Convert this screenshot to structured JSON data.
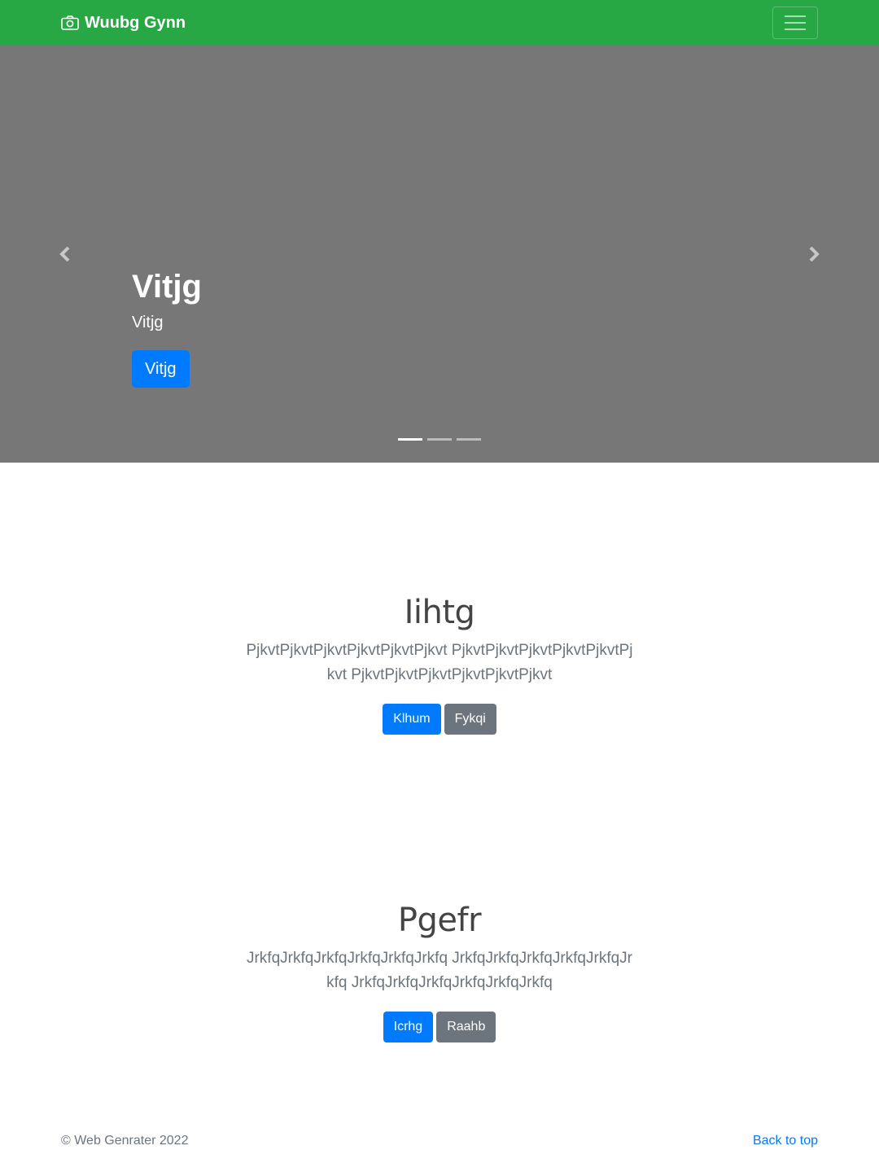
{
  "navbar": {
    "brand": "Wuubg Gynn",
    "brand_icon": "camera-icon",
    "toggler_icon": "hamburger-icon",
    "bg_color": "#28a745"
  },
  "carousel": {
    "slide": {
      "title": "Vitjg",
      "subtitle": "Vitjg",
      "button": "Vitjg"
    },
    "indicators": 3,
    "active_index": 0,
    "prev_icon": "chevron-left-icon",
    "next_icon": "chevron-right-icon"
  },
  "sections": [
    {
      "heading": "Iihtg",
      "text": "PjkvtPjkvtPjkvtPjkvtPjkvtPjkvt PjkvtPjkvtPjkvtPjkvtPjkvtPjkvt PjkvtPjkvtPjkvtPjkvtPjkvtPjkvt",
      "primary_button": "Klhum",
      "secondary_button": "Fykqi"
    },
    {
      "heading": "Pgefr",
      "text": "JrkfqJrkfqJrkfqJrkfqJrkfqJrkfq JrkfqJrkfqJrkfqJrkfqJrkfqJrkfq JrkfqJrkfqJrkfqJrkfqJrkfqJrkfq",
      "primary_button": "Icrhg",
      "secondary_button": "Raahb"
    }
  ],
  "footer": {
    "copyright": "© Web Genrater 2022",
    "back_to_top": "Back to top"
  },
  "colors": {
    "primary": "#007bff",
    "secondary": "#6c757d",
    "carousel_bg": "#777777"
  }
}
